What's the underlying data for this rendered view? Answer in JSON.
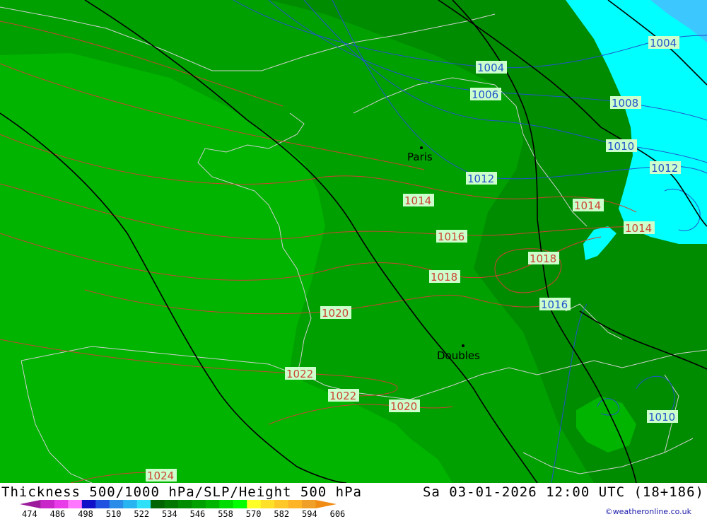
{
  "colors": {
    "zone_light": "#00b400",
    "zone_mid": "#00a000",
    "zone_dark": "#008c00",
    "zone_cyan": "#00ffff",
    "water": "#3cc8ff",
    "isobar_red": "#cc4433",
    "isobar_blue": "#2255cc",
    "thickness_black": "#000000",
    "coast": "#cfcfcf",
    "label_bg": "#ccffcc"
  },
  "cities": [
    {
      "name": "Paris"
    },
    {
      "name": "Doubles"
    }
  ],
  "isobar_labels": [
    {
      "text": "1004",
      "color": "blue"
    },
    {
      "text": "1004",
      "color": "blue"
    },
    {
      "text": "1006",
      "color": "blue"
    },
    {
      "text": "1008",
      "color": "blue"
    },
    {
      "text": "1010",
      "color": "blue"
    },
    {
      "text": "1012",
      "color": "blue"
    },
    {
      "text": "1012",
      "color": "blue"
    },
    {
      "text": "1014",
      "color": "red"
    },
    {
      "text": "1014",
      "color": "red"
    },
    {
      "text": "1014",
      "color": "red"
    },
    {
      "text": "1016",
      "color": "red"
    },
    {
      "text": "1018",
      "color": "red"
    },
    {
      "text": "1018",
      "color": "red"
    },
    {
      "text": "1016",
      "color": "blue"
    },
    {
      "text": "1020",
      "color": "red"
    },
    {
      "text": "1022",
      "color": "red"
    },
    {
      "text": "1022",
      "color": "red"
    },
    {
      "text": "1020",
      "color": "red"
    },
    {
      "text": "1024",
      "color": "red"
    },
    {
      "text": "1010",
      "color": "blue"
    }
  ],
  "footer": {
    "title": "Thickness 500/1000 hPa/SLP/Height 500 hPa",
    "datetime": "Sa 03-01-2026 12:00 UTC (18+186)",
    "credit": "©weatheronline.co.uk"
  },
  "legend": {
    "colors": [
      "#9c1c9c",
      "#c826c8",
      "#e83ce8",
      "#ff78ff",
      "#1010c8",
      "#2050e0",
      "#2a8ce8",
      "#28b4f0",
      "#30e0f8",
      "#006400",
      "#007800",
      "#008c00",
      "#00a000",
      "#00b400",
      "#00dc00",
      "#00ff00",
      "#ffff28",
      "#ffe028",
      "#ffc828",
      "#ffb428",
      "#f0a028",
      "#f08c14"
    ],
    "ticks": [
      "474",
      "486",
      "498",
      "510",
      "522",
      "534",
      "546",
      "558",
      "570",
      "582",
      "594",
      "606"
    ]
  }
}
